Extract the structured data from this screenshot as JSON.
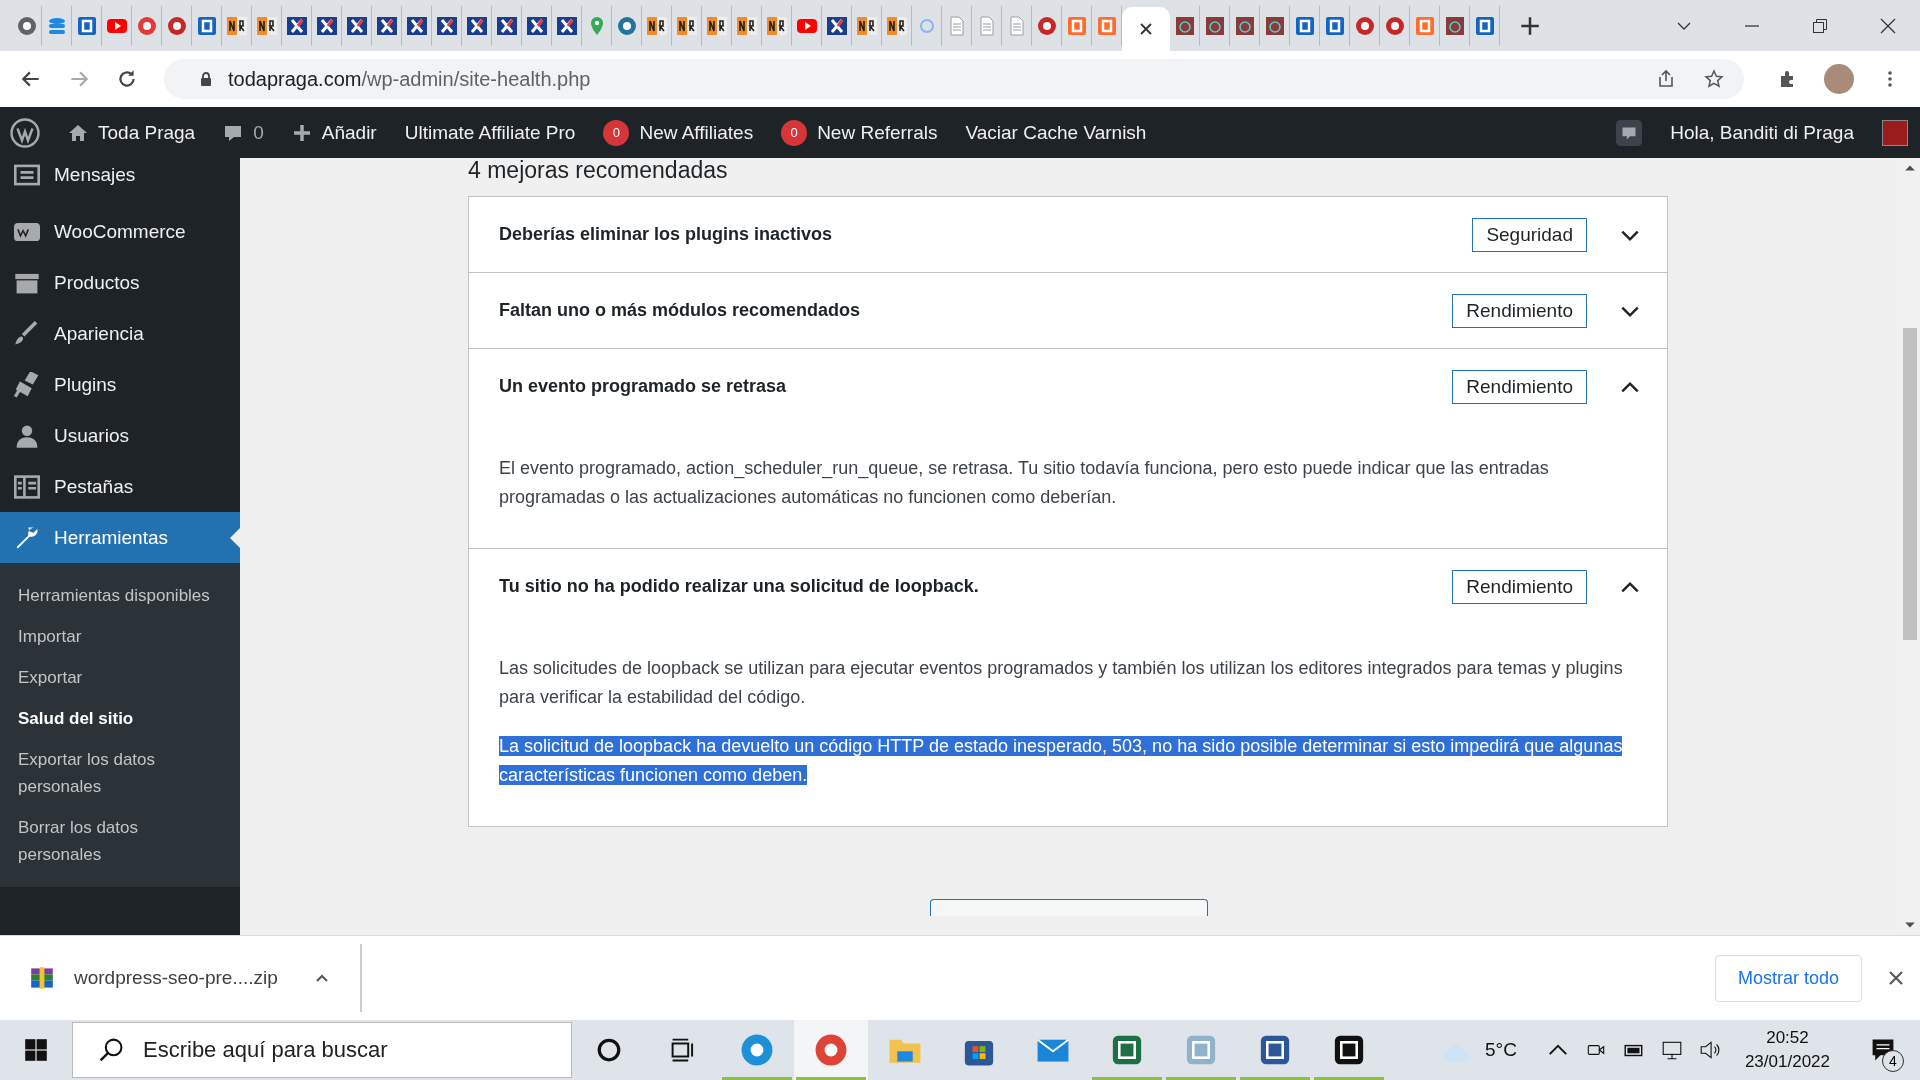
{
  "browser": {
    "tabs": [
      {
        "kind": "globe",
        "selected": false
      },
      {
        "kind": "database",
        "selected": false
      },
      {
        "kind": "letter",
        "selected": false
      },
      {
        "kind": "play",
        "selected": false
      },
      {
        "kind": "letter-round",
        "selected": false
      },
      {
        "kind": "letter-round-red",
        "selected": false
      },
      {
        "kind": "letter",
        "selected": false
      },
      {
        "kind": "split",
        "selected": false
      },
      {
        "kind": "split",
        "selected": false
      },
      {
        "kind": "cross",
        "selected": false
      },
      {
        "kind": "cross",
        "selected": false
      },
      {
        "kind": "cross",
        "selected": false
      },
      {
        "kind": "cross",
        "selected": false
      },
      {
        "kind": "cross",
        "selected": false
      },
      {
        "kind": "cross",
        "selected": false
      },
      {
        "kind": "cross",
        "selected": false
      },
      {
        "kind": "cross",
        "selected": false
      },
      {
        "kind": "cross",
        "selected": false
      },
      {
        "kind": "cross",
        "selected": false
      },
      {
        "kind": "pin",
        "selected": false
      },
      {
        "kind": "wp",
        "selected": false
      },
      {
        "kind": "split",
        "selected": false
      },
      {
        "kind": "split",
        "selected": false
      },
      {
        "kind": "split",
        "selected": false
      },
      {
        "kind": "split",
        "selected": false
      },
      {
        "kind": "split",
        "selected": false
      },
      {
        "kind": "play",
        "selected": false
      },
      {
        "kind": "cross",
        "selected": false
      },
      {
        "kind": "split",
        "selected": false
      },
      {
        "kind": "split",
        "selected": false
      },
      {
        "kind": "ring",
        "selected": false
      },
      {
        "kind": "document",
        "selected": false
      },
      {
        "kind": "document",
        "selected": false
      },
      {
        "kind": "document",
        "selected": false
      },
      {
        "kind": "letter-round-red",
        "selected": false
      },
      {
        "kind": "letter-orange",
        "selected": false
      },
      {
        "kind": "letter-orange",
        "selected": false
      },
      {
        "selected": true
      },
      {
        "kind": "picture",
        "selected": false
      },
      {
        "kind": "picture",
        "selected": false
      },
      {
        "kind": "picture",
        "selected": false
      },
      {
        "kind": "picture",
        "selected": false
      },
      {
        "kind": "letter",
        "selected": false
      },
      {
        "kind": "letter",
        "selected": false
      },
      {
        "kind": "letter-round-red",
        "selected": false
      },
      {
        "kind": "letter-round-red",
        "selected": false
      },
      {
        "kind": "letter-orange",
        "selected": false
      },
      {
        "kind": "picture",
        "selected": false
      },
      {
        "kind": "letter",
        "selected": false
      }
    ],
    "address": {
      "host": "todapraga.com",
      "path": "/wp-admin/site-health.php"
    },
    "forward_disabled": true
  },
  "admin_bar": {
    "site": "Toda Praga",
    "comments": "0",
    "new": "Añadir",
    "items": [
      {
        "kind": "plain",
        "label": "Ultimate Affiliate Pro"
      },
      {
        "kind": "count",
        "count": "0",
        "label": "New Affiliates"
      },
      {
        "kind": "count",
        "count": "0",
        "label": "New Referrals"
      },
      {
        "kind": "plain",
        "label": "Vaciar Cache Varnish"
      }
    ],
    "greeting": "Hola, Banditi di Praga"
  },
  "sidebar": {
    "items": [
      {
        "kind": "mail",
        "label": "Mensajes",
        "selected": false
      },
      {
        "kind": "woo",
        "label": "WooCommerce",
        "selected": false
      },
      {
        "kind": "box",
        "label": "Productos",
        "selected": false
      },
      {
        "kind": "brush",
        "label": "Apariencia",
        "selected": false
      },
      {
        "kind": "plug",
        "label": "Plugins",
        "selected": false
      },
      {
        "kind": "user",
        "label": "Usuarios",
        "selected": false
      },
      {
        "kind": "columns",
        "label": "Pestañas",
        "selected": false
      },
      {
        "kind": "wrench",
        "label": "Herramientas",
        "selected": true
      }
    ],
    "submenu": [
      {
        "label": "Herramientas disponibles",
        "selected": false
      },
      {
        "label": "Importar",
        "selected": false
      },
      {
        "label": "Exportar",
        "selected": false
      },
      {
        "label": "Salud del sitio",
        "selected": true
      },
      {
        "label": "Exportar los datos personales",
        "selected": false
      },
      {
        "label": "Borrar los datos personales",
        "selected": false
      }
    ]
  },
  "content": {
    "heading": "4 mejoras recomendadas",
    "issues": [
      {
        "title": "Deberías eliminar los plugins inactivos",
        "badge": "Seguridad",
        "expanded": false
      },
      {
        "title": "Faltan uno o más módulos recomendados",
        "badge": "Rendimiento",
        "expanded": false
      },
      {
        "title": "Un evento programado se retrasa",
        "badge": "Rendimiento",
        "expanded": true,
        "paragraphs": [
          {
            "text": "El evento programado, action_scheduler_run_queue, se retrasa. Tu sitio todavía funciona, pero esto puede indicar que las entradas programadas o las actualizaciones automáticas no funcionen como deberían.",
            "highlighted": false
          }
        ]
      },
      {
        "title": "Tu sitio no ha podido realizar una solicitud de loopback.",
        "badge": "Rendimiento",
        "expanded": true,
        "paragraphs": [
          {
            "text": "Las solicitudes de loopback se utilizan para ejecutar eventos programados y también los utilizan los editores integrados para temas y plugins para verificar la estabilidad del código.",
            "highlighted": false
          },
          {
            "text": "La solicitud de loopback ha devuelto un código HTTP de estado inesperado, 503, no ha sido posible determinar si esto impedirá que algunas características funcionen como deben.",
            "highlighted": true
          }
        ]
      }
    ]
  },
  "download_bar": {
    "file": "wordpress-seo-pre....zip",
    "show_all": "Mostrar todo"
  },
  "taskbar": {
    "search": {
      "placeholder": "Escribe aquí para buscar"
    },
    "apps": [
      {
        "kind": "edge",
        "running": true,
        "active": false
      },
      {
        "kind": "chrome",
        "running": true,
        "active": true
      },
      {
        "kind": "folder",
        "running": false,
        "active": false
      },
      {
        "kind": "store",
        "running": false,
        "active": false
      },
      {
        "kind": "mail",
        "running": false,
        "active": false
      },
      {
        "kind": "excel",
        "running": true,
        "active": false
      },
      {
        "kind": "notepad",
        "running": true,
        "active": false
      },
      {
        "kind": "word",
        "running": true,
        "active": false
      },
      {
        "kind": "vpn",
        "running": true,
        "active": false
      }
    ],
    "temperature": "5°C",
    "time": "20:52",
    "date": "23/01/2022",
    "notifications": "4"
  }
}
